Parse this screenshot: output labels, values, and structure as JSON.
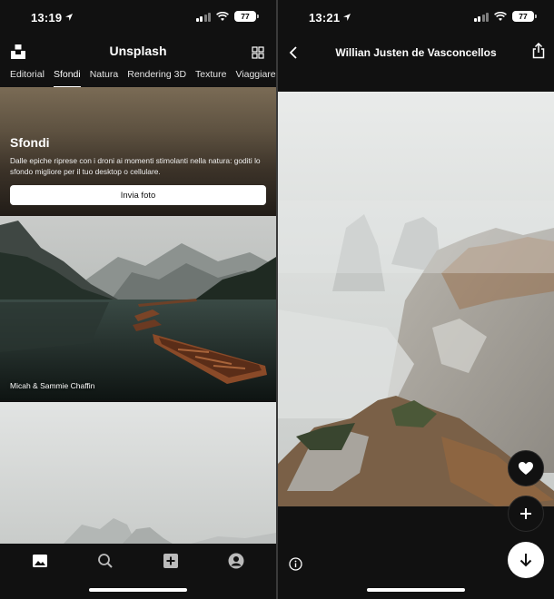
{
  "left": {
    "status": {
      "time": "13:19",
      "battery": "77"
    },
    "header": {
      "title": "Unsplash"
    },
    "tabs": [
      "Editorial",
      "Sfondi",
      "Natura",
      "Rendering 3D",
      "Texture",
      "Viaggiare"
    ],
    "active_tab": "Sfondi",
    "hero": {
      "title": "Sfondi",
      "description": "Dalle epiche riprese con i droni ai momenti stimolanti nella natura: goditi lo sfondo migliore per il tuo desktop o cellulare.",
      "button": "Invia foto"
    },
    "photos": [
      {
        "credit": "Micah & Sammie Chaffin"
      }
    ],
    "nav": {
      "icons": [
        "image-icon",
        "search-icon",
        "add-square-icon",
        "account-icon"
      ]
    }
  },
  "right": {
    "status": {
      "time": "13:21",
      "battery": "77"
    },
    "header": {
      "title": "Willian Justen de Vasconcellos"
    },
    "icons": [
      "back-icon",
      "share-icon",
      "heart-icon",
      "plus-icon",
      "download-icon",
      "info-icon"
    ]
  },
  "colors": {
    "background": "#111111",
    "text": "#ffffff",
    "button_bg": "#ffffff"
  }
}
